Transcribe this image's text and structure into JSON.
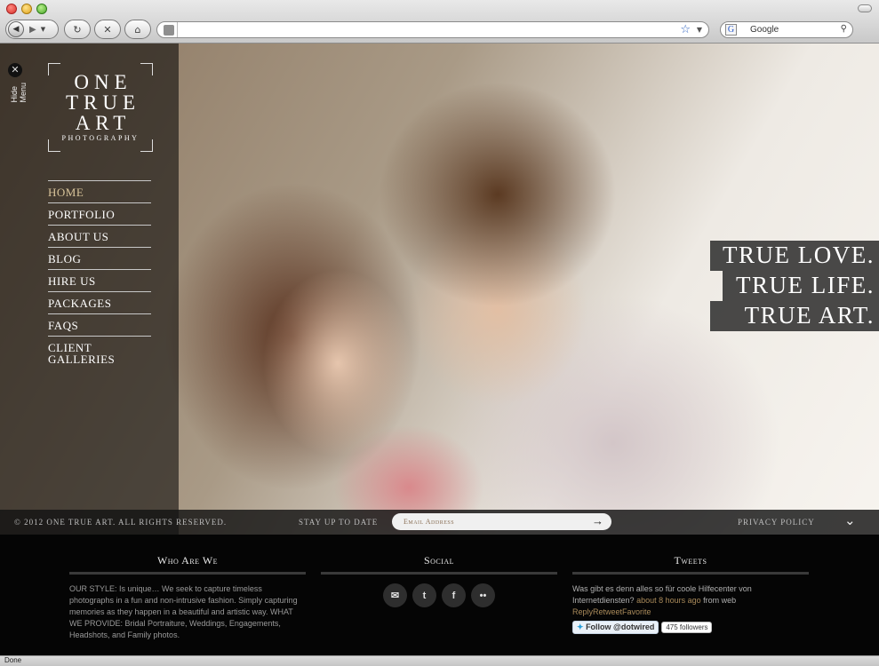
{
  "browser": {
    "search_placeholder": "Google",
    "status": "Done",
    "icons": [
      "back-icon",
      "forward-icon",
      "reload-icon",
      "stop-icon",
      "home-icon",
      "bookmark-star-icon",
      "search-icon"
    ]
  },
  "sidebar": {
    "hide_menu": "Hide Menu",
    "logo": {
      "line1": "ONE",
      "line2": "TRUE",
      "line3": "ART",
      "sub": "PHOTOGRAPHY"
    },
    "menu": [
      {
        "label": "HOME",
        "active": true
      },
      {
        "label": "PORTFOLIO"
      },
      {
        "label": "ABOUT US"
      },
      {
        "label": "BLOG"
      },
      {
        "label": "HIRE US"
      },
      {
        "label": "PACKAGES"
      },
      {
        "label": "FAQS"
      },
      {
        "label": "CLIENT",
        "label2": "GALLERIES"
      }
    ]
  },
  "hero": {
    "tagline": [
      "TRUE LOVE.",
      "TRUE LIFE.",
      "TRUE ART."
    ]
  },
  "footbar": {
    "copyright": "© 2012 ONE TRUE ART. ALL RIGHTS RESERVED.",
    "stay": "STAY UP TO DATE",
    "email_placeholder": "Email Address",
    "privacy": "PRIVACY POLICY"
  },
  "footer": {
    "who": {
      "title": "Who Are We",
      "text": "OUR STYLE: Is unique… We seek to capture timeless photographs in a fun and non-intrusive fashion. Simply capturing memories as they happen in a beautiful and artistic way. WHAT WE PROVIDE: Bridal Portraiture, Weddings, Engagements, Headshots, and Family photos."
    },
    "social": {
      "title": "Social"
    },
    "tweets": {
      "title": "Tweets",
      "text": "Was gibt es denn alles so für coole Hilfecenter von Internetdiensten?",
      "time": "about 8 hours ago",
      "from": "from web",
      "actions": "ReplyRetweetFavorite",
      "follow": "Follow @dotwired",
      "followers": "475 followers"
    }
  },
  "colors": {
    "accent": "#d8c49a",
    "link": "#a98a5a"
  }
}
